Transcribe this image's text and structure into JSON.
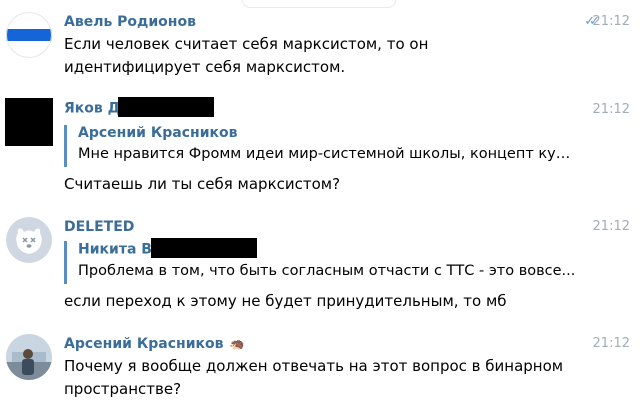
{
  "messages": [
    {
      "author": "Авель Родионов",
      "time": "21:12",
      "read_marker": "✓✓",
      "text": "Если человек считает себя марксистом, то он идентифицирует себя марксистом."
    },
    {
      "author": "Яков Д",
      "time": "21:12",
      "reply_author": "Арсений Красников",
      "reply_text": "Мне нравится Фромм идеи мир-системной школы, концепт кул...",
      "text": "Считаешь ли ты себя марксистом?"
    },
    {
      "author": "DELETED",
      "time": "21:12",
      "reply_author": "Никита В",
      "reply_text": "Проблема в том, что быть согласным отчасти с ТТС - это вовсе...",
      "text": "если переход к этому не будет принудительным, то мб"
    },
    {
      "author": "Арсений Красников",
      "author_badge": "🦔",
      "time": "21:12",
      "text": "Почему я вообще должен отвечать на этот вопрос в бинарном пространстве?"
    }
  ]
}
